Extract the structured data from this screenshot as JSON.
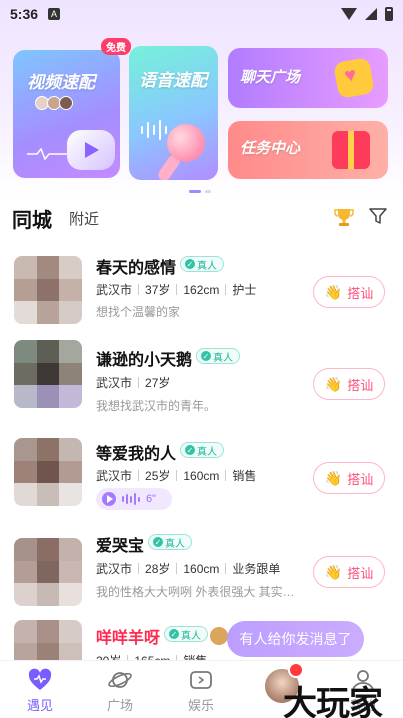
{
  "status_bar": {
    "time": "5:36",
    "notif_letter": "A"
  },
  "banners": {
    "video": {
      "title": "视频速配",
      "badge": "免费"
    },
    "voice": {
      "title": "语音速配"
    },
    "chat": {
      "title": "聊天广场"
    },
    "task": {
      "title": "任务中心"
    }
  },
  "tabs": {
    "active": "同城",
    "inactive": "附近"
  },
  "users": [
    {
      "name": "春天的感情",
      "verified": "真人",
      "meta": [
        "武汉市",
        "37岁",
        "162cm",
        "护士"
      ],
      "bio": "想找个温馨的家",
      "action": "搭讪"
    },
    {
      "name": "谦逊的小天鹅",
      "verified": "真人",
      "meta": [
        "武汉市",
        "27岁"
      ],
      "bio": "我想找武汉市的青年。",
      "action": "搭讪"
    },
    {
      "name": "等爱我的人",
      "verified": "真人",
      "meta": [
        "武汉市",
        "25岁",
        "160cm",
        "销售"
      ],
      "voice": "6\"",
      "action": "搭讪"
    },
    {
      "name": "爱哭宝",
      "verified": "真人",
      "meta": [
        "武汉市",
        "28岁",
        "160cm",
        "业务跟单"
      ],
      "bio": "我的性格大大咧咧 外表很强大 其实…",
      "action": "搭讪"
    },
    {
      "name": "咩咩羊呀",
      "verified": "真人",
      "meta": [
        "20岁",
        "165cm",
        "销售"
      ]
    }
  ],
  "toast": "有人给你发消息了",
  "nav": {
    "meet": "遇见",
    "square": "广场",
    "fun": "娱乐",
    "mine": "我的"
  },
  "watermark": "大玩家",
  "colors": {
    "accent": "#7a5cff",
    "chat_btn": "#ff4d79",
    "verified": "#1fb69a"
  }
}
